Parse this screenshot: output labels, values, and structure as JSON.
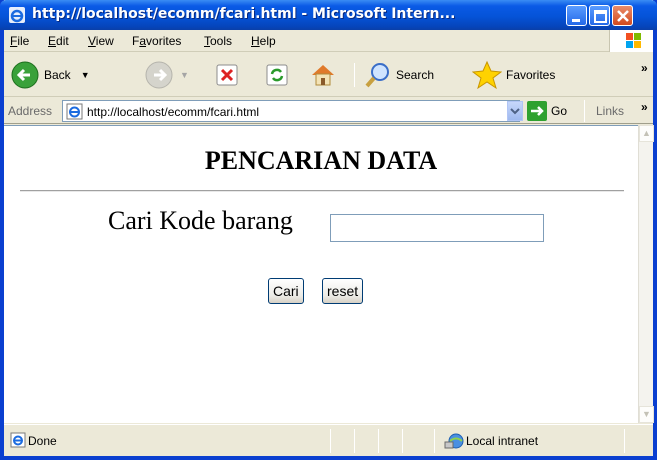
{
  "window": {
    "title": "http://localhost/ecomm/fcari.html - Microsoft Intern..."
  },
  "menu": {
    "items": [
      "File",
      "Edit",
      "View",
      "Favorites",
      "Tools",
      "Help"
    ],
    "accel": [
      "F",
      "E",
      "V",
      "a",
      "T",
      "H"
    ]
  },
  "toolbar": {
    "back_label": "Back",
    "search_label": "Search",
    "favorites_label": "Favorites"
  },
  "address": {
    "label": "Address",
    "url": "http://localhost/ecomm/fcari.html",
    "go_label": "Go",
    "links_label": "Links"
  },
  "page": {
    "heading": "PENCARIAN DATA",
    "search_label": "Cari Kode barang",
    "search_value": "",
    "submit_label": "Cari",
    "reset_label": "reset"
  },
  "status": {
    "text": "Done",
    "zone": "Local intranet"
  },
  "colors": {
    "titlebar": "#0553d8",
    "window_border": "#0a3fd0",
    "chrome": "#ece9d8",
    "input_border": "#7f9db9",
    "button_border": "#003c74"
  }
}
